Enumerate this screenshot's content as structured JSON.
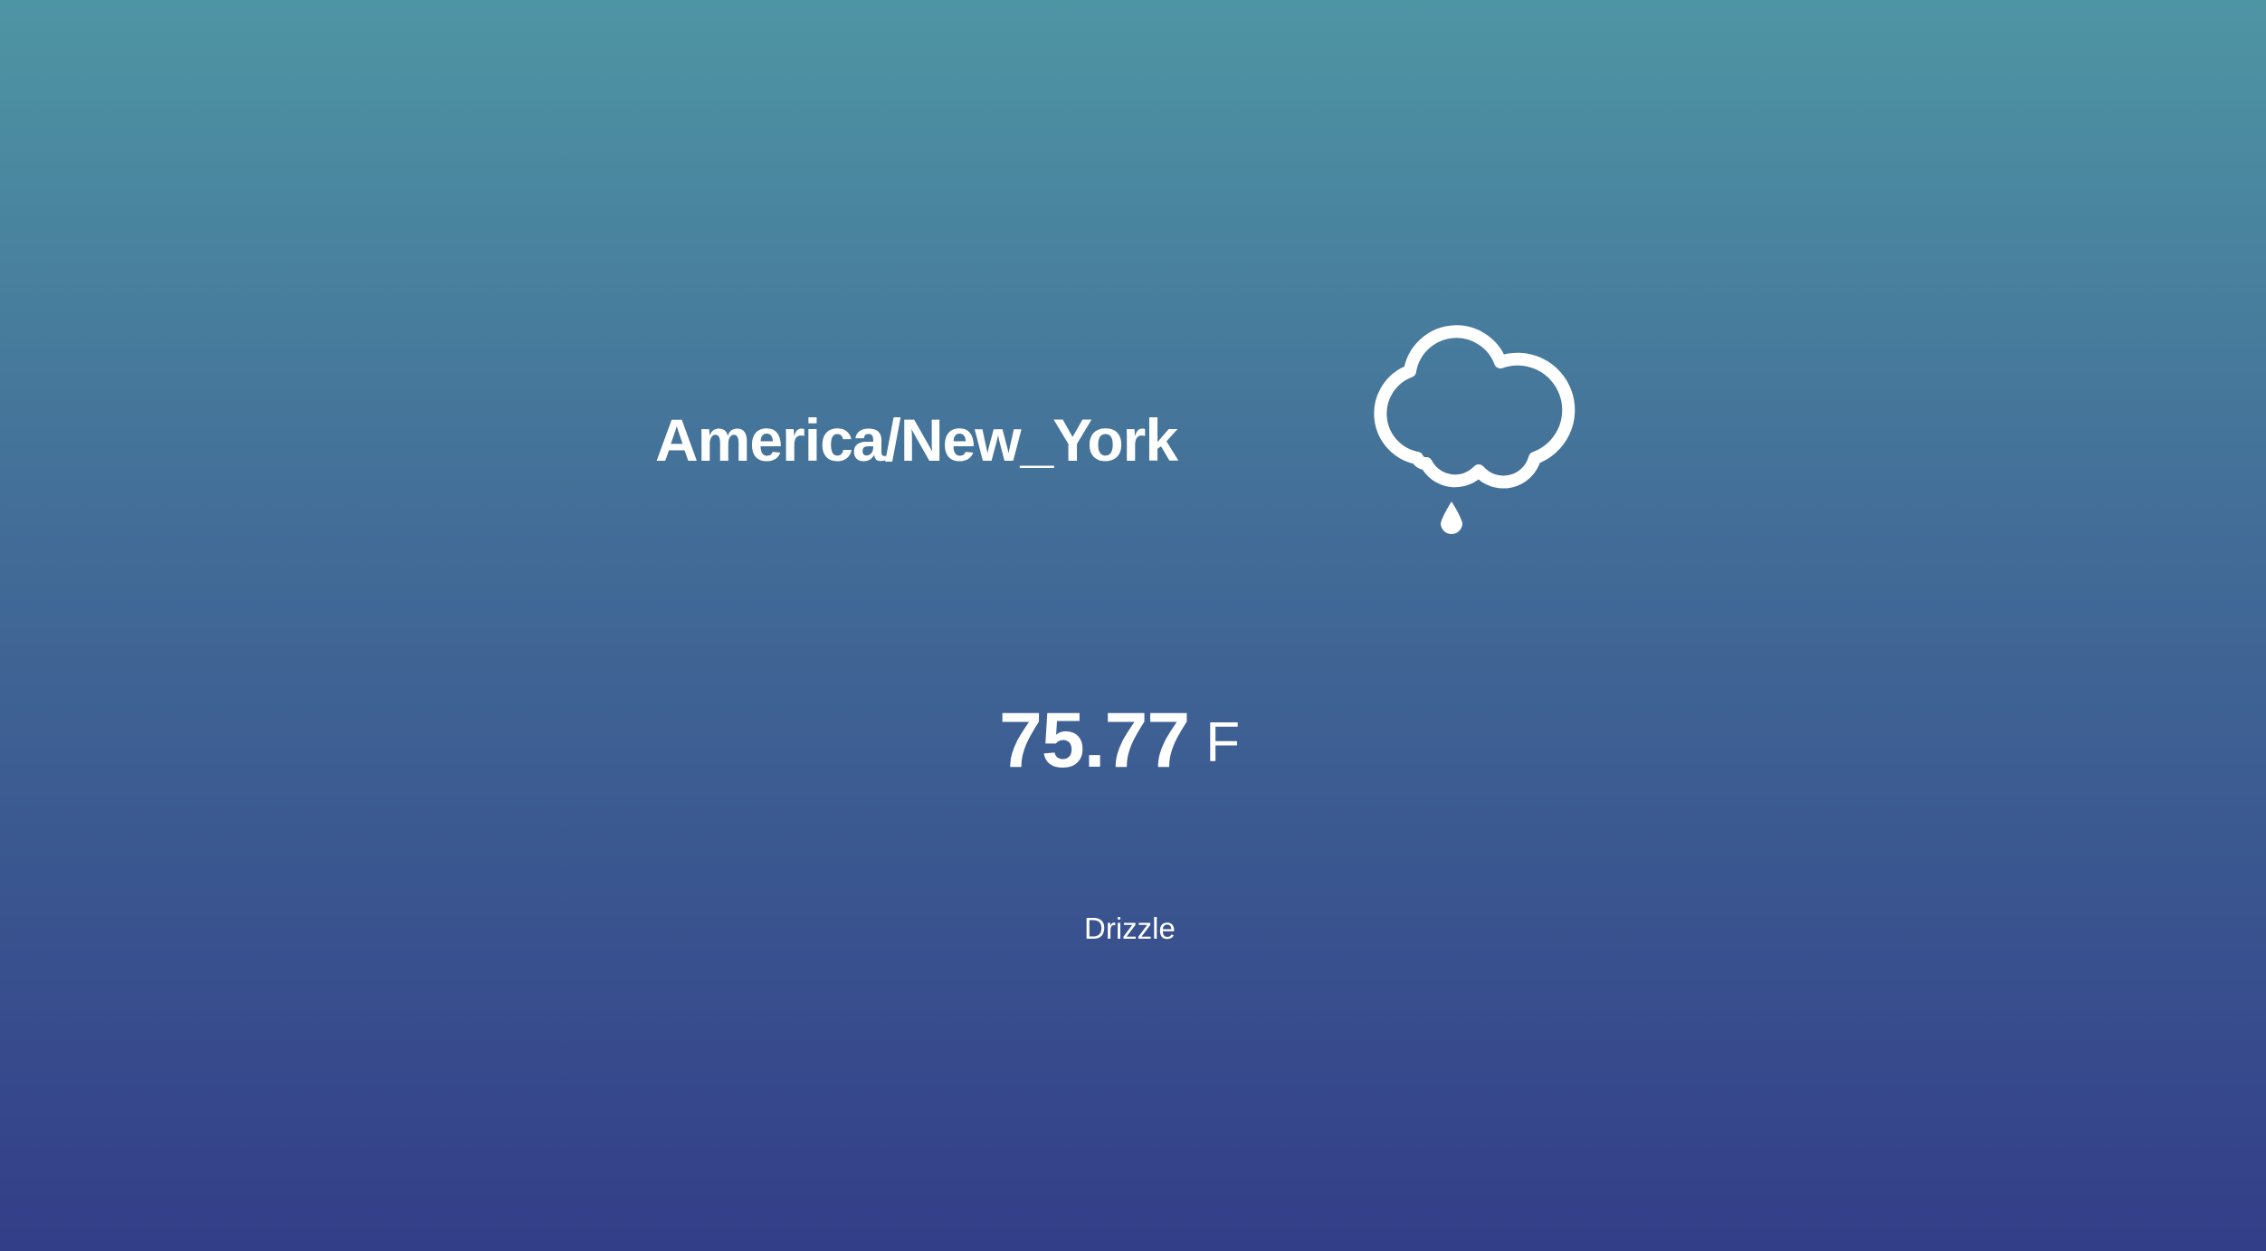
{
  "location": "America/New_York",
  "temperature": {
    "value": "75.77",
    "unit": "F"
  },
  "condition": "Drizzle",
  "icon": "drizzle-cloud-icon",
  "colors": {
    "gradient_top": "#4e95a4",
    "gradient_bottom": "#333e88",
    "text": "#ffffff"
  }
}
